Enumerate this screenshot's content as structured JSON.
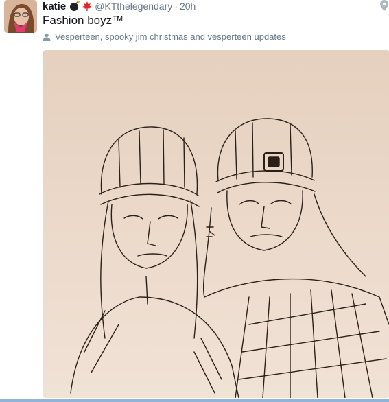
{
  "tweet": {
    "author_name": "katie",
    "handle": "@KTthelegendary",
    "separator": "·",
    "time": "20h",
    "text": "Fashion boyz™",
    "context": "Vesperteen, spooky jim christmas and vesperteen updates"
  },
  "icons": {
    "avatar": "avatar",
    "emoji_1": "bomb-emoji",
    "emoji_2": "maple-leaf-emoji",
    "location": "location-pin-icon",
    "context": "person-icon"
  },
  "colors": {
    "text": "#14171a",
    "secondary": "#657786",
    "accent": "#8fb4d8",
    "paper": "#ecd8c8"
  }
}
